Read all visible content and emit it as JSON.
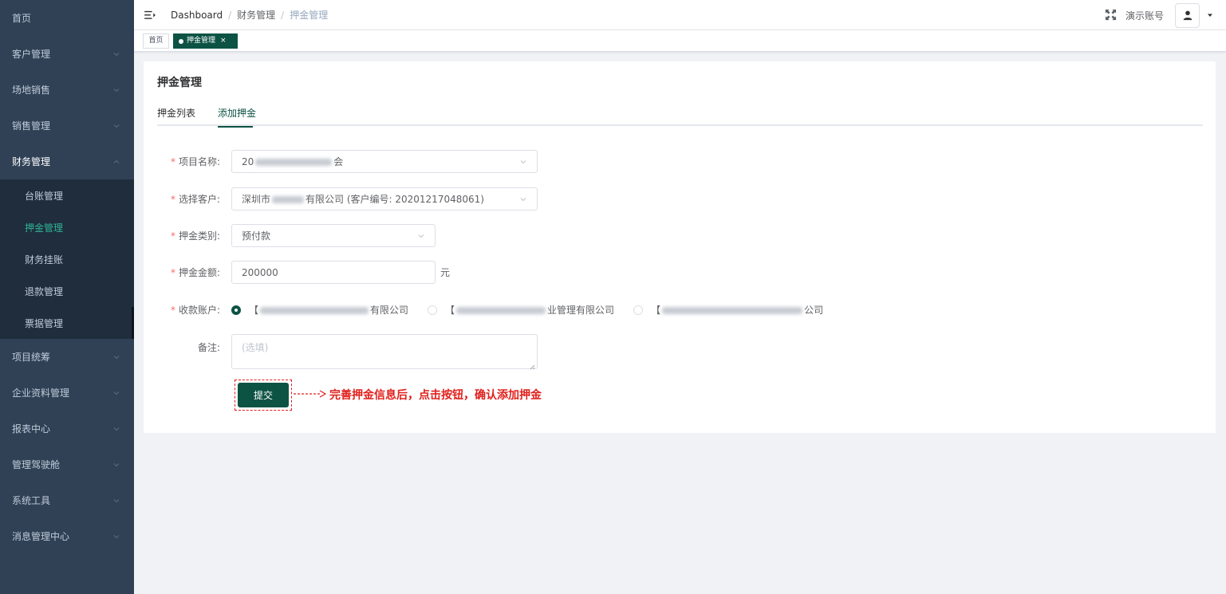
{
  "sidebar": {
    "items": [
      {
        "label": "首页"
      },
      {
        "label": "客户管理"
      },
      {
        "label": "场地销售"
      },
      {
        "label": "销售管理"
      },
      {
        "label": "财务管理"
      },
      {
        "label": "项目统筹"
      },
      {
        "label": "企业资料管理"
      },
      {
        "label": "报表中心"
      },
      {
        "label": "管理驾驶舱"
      },
      {
        "label": "系统工具"
      },
      {
        "label": "消息管理中心"
      }
    ],
    "finance_submenu": [
      {
        "label": "台账管理"
      },
      {
        "label": "押金管理"
      },
      {
        "label": "财务挂账"
      },
      {
        "label": "退款管理"
      },
      {
        "label": "票据管理"
      }
    ]
  },
  "header": {
    "breadcrumb": [
      "Dashboard",
      "财务管理",
      "押金管理"
    ],
    "breadcrumb_sep": "/",
    "account": "演示账号"
  },
  "tags": {
    "home": "首页",
    "active": "押金管理",
    "close": "×"
  },
  "page": {
    "title": "押金管理",
    "tabs": [
      "押金列表",
      "添加押金"
    ]
  },
  "form": {
    "required_mark": "*",
    "project": {
      "label": "项目名称:",
      "value_prefix": "20",
      "value_suffix": "会"
    },
    "customer": {
      "label": "选择客户:",
      "value_prefix": "深圳市",
      "value_suffix": "有限公司 (客户编号: 20201217048061)"
    },
    "category": {
      "label": "押金类别:",
      "value": "预付款"
    },
    "amount": {
      "label": "押金金额:",
      "value": "200000",
      "unit": "元"
    },
    "account": {
      "label": "收款账户:",
      "options": [
        {
          "prefix": "【",
          "suffix": "有限公司"
        },
        {
          "prefix": "【",
          "suffix": "业管理有限公司"
        },
        {
          "prefix": "【",
          "suffix": "公司"
        }
      ]
    },
    "remark": {
      "label": "备注:",
      "placeholder": "(选填)"
    },
    "submit": "提交"
  },
  "annotation": {
    "text": "完善押金信息后，点击按钮，确认添加押金"
  },
  "colors": {
    "sidebar_bg": "#304156",
    "submenu_bg": "#1f2d3d",
    "primary": "#0d5344",
    "active_menu": "#2fb493",
    "annotation": "#e0201c"
  }
}
